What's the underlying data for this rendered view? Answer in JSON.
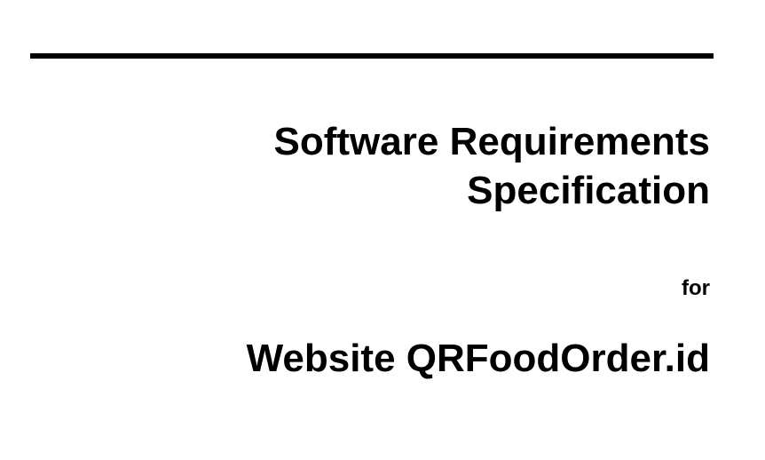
{
  "document": {
    "title_line_1": "Software Requirements",
    "title_line_2": "Specification",
    "for_label": "for",
    "product_name": "Website QRFoodOrder.id"
  }
}
